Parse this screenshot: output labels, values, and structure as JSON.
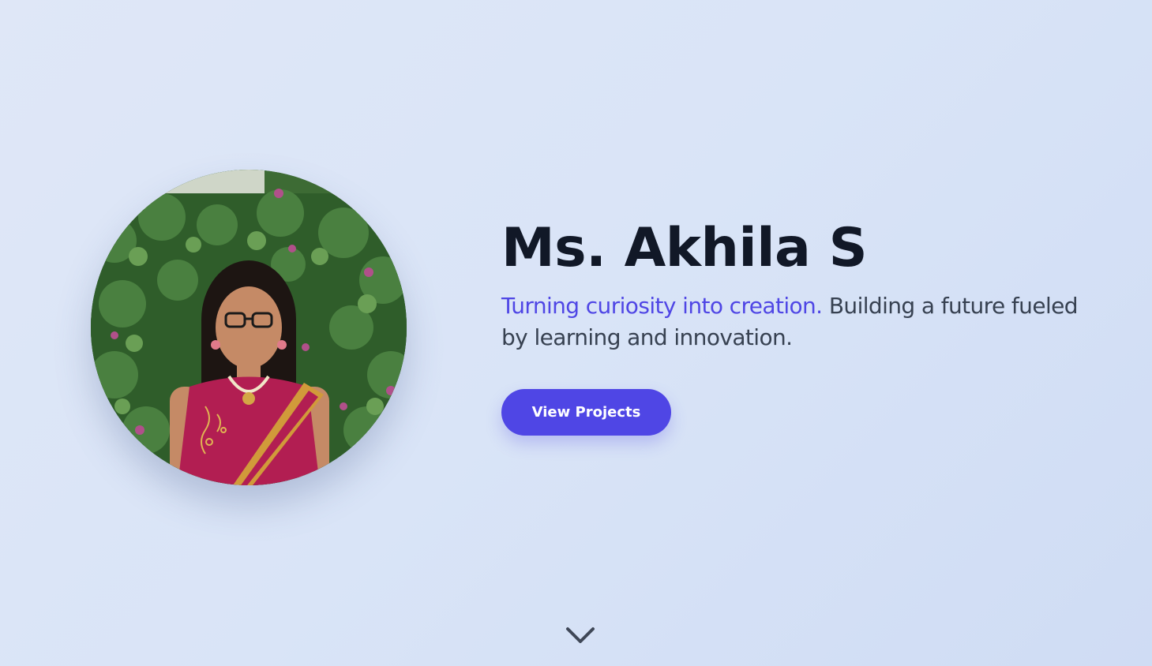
{
  "hero": {
    "name": "Ms. Akhila S",
    "tagline_accent": "Turning curiosity into creation.",
    "tagline_rest": "Building a future fueled by learning and innovation.",
    "cta_label": "View Projects",
    "profile_photo": {
      "alt": "Profile photo"
    },
    "scroll_icon": "chevron-down-icon"
  },
  "colors": {
    "accent": "#4f46e5",
    "heading": "#111827",
    "body_text": "#374151",
    "background": "#dbe5f6"
  }
}
